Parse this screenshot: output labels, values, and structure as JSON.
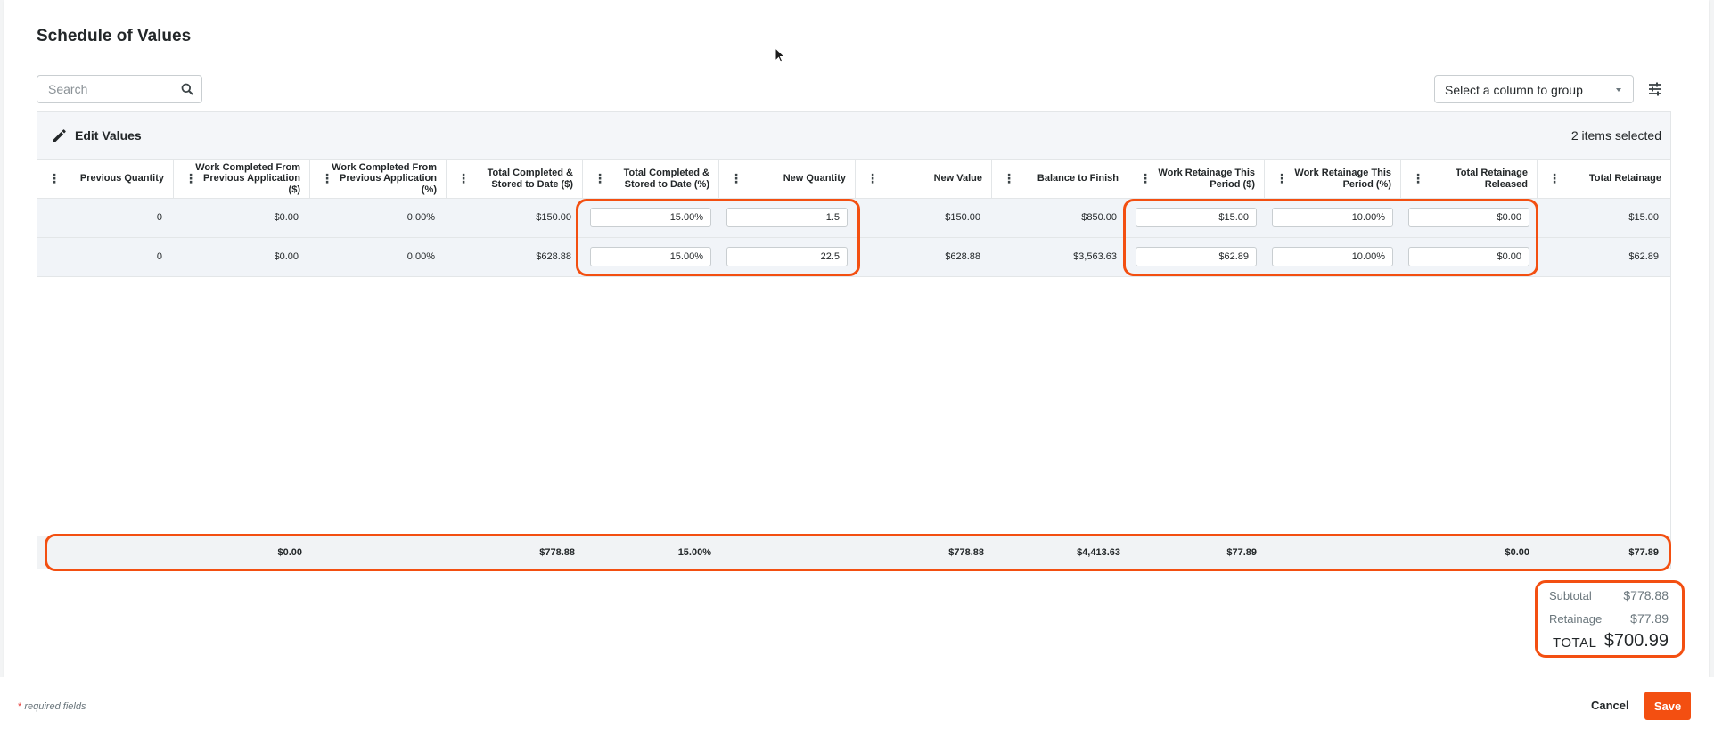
{
  "page": {
    "title": "Schedule of Values",
    "search": {
      "placeholder": "Search"
    },
    "group_select": {
      "placeholder": "Select a column to group"
    }
  },
  "grid": {
    "edit_label": "Edit Values",
    "selection_count": "2 items selected",
    "columns": [
      {
        "key": "prev_qty",
        "label": "Previous Quantity"
      },
      {
        "key": "wc_prev_usd",
        "label": "Work Completed From Previous Application ($)"
      },
      {
        "key": "wc_prev_pct",
        "label": "Work Completed From Previous Application (%)"
      },
      {
        "key": "total_completed_usd",
        "label": "Total Completed & Stored to Date ($)"
      },
      {
        "key": "total_completed_pct",
        "label": "Total Completed & Stored to Date (%)"
      },
      {
        "key": "new_qty",
        "label": "New Quantity"
      },
      {
        "key": "new_value",
        "label": "New Value"
      },
      {
        "key": "balance",
        "label": "Balance to Finish"
      },
      {
        "key": "wr_usd",
        "label": "Work Retainage This Period ($)"
      },
      {
        "key": "wr_pct",
        "label": "Work Retainage This Period (%)"
      },
      {
        "key": "tr_released",
        "label": "Total Retainage Released"
      },
      {
        "key": "total_retainage",
        "label": "Total Retainage"
      }
    ],
    "rows": [
      {
        "prev_qty": "0",
        "wc_prev_usd": "$0.00",
        "wc_prev_pct": "0.00%",
        "total_completed_usd": "$150.00",
        "total_completed_pct": "15.00%",
        "new_qty": "1.5",
        "new_value": "$150.00",
        "balance": "$850.00",
        "wr_usd": "$15.00",
        "wr_pct": "10.00%",
        "tr_released": "$0.00",
        "total_retainage": "$15.00"
      },
      {
        "prev_qty": "0",
        "wc_prev_usd": "$0.00",
        "wc_prev_pct": "0.00%",
        "total_completed_usd": "$628.88",
        "total_completed_pct": "15.00%",
        "new_qty": "22.5",
        "new_value": "$628.88",
        "balance": "$3,563.63",
        "wr_usd": "$62.89",
        "wr_pct": "10.00%",
        "tr_released": "$0.00",
        "total_retainage": "$62.89"
      }
    ],
    "totals": {
      "wc_prev_usd": "$0.00",
      "total_completed_usd": "$778.88",
      "total_completed_pct": "15.00%",
      "new_value": "$778.88",
      "balance": "$4,413.63",
      "wr_usd": "$77.89",
      "tr_released": "$0.00",
      "total_retainage": "$77.89"
    }
  },
  "summary": {
    "subtotal_label": "Subtotal",
    "subtotal": "$778.88",
    "retainage_label": "Retainage",
    "retainage": "$77.89",
    "total_label": "TOTAL",
    "total": "$700.99"
  },
  "footer": {
    "required_star": "*",
    "required_text": "required fields",
    "cancel_label": "Cancel",
    "save_label": "Save"
  },
  "colors": {
    "accent": "#f34f11",
    "grid_bg": "#f4f6f9",
    "text": "#232729"
  }
}
